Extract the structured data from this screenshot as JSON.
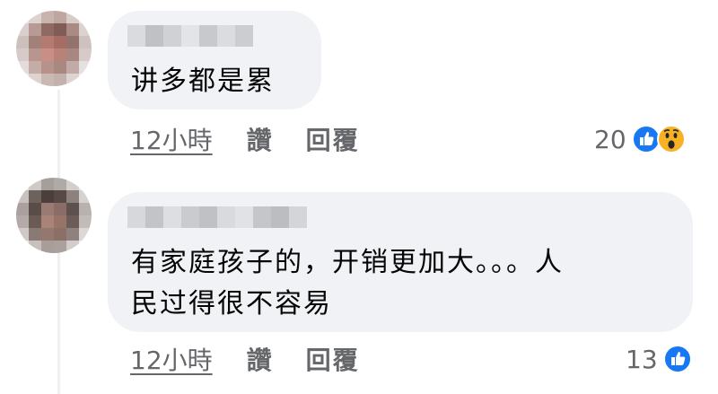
{
  "comments": [
    {
      "text": "讲多都是累",
      "time": "12小時",
      "like_label": "讚",
      "reply_label": "回覆",
      "reaction_count": "20",
      "reactions": [
        "like-icon",
        "wow-icon"
      ]
    },
    {
      "text": "有家庭孩子的，开销更加大。。。人\n民过得很不容易",
      "time": "12小時",
      "like_label": "讚",
      "reply_label": "回覆",
      "reaction_count": "13",
      "reactions": [
        "like-icon"
      ]
    }
  ],
  "colors": {
    "bubble": "#f0f2f5",
    "meta_text": "#65676b",
    "like_blue": "#1877f2",
    "wow_yellow": "#f7b125"
  }
}
